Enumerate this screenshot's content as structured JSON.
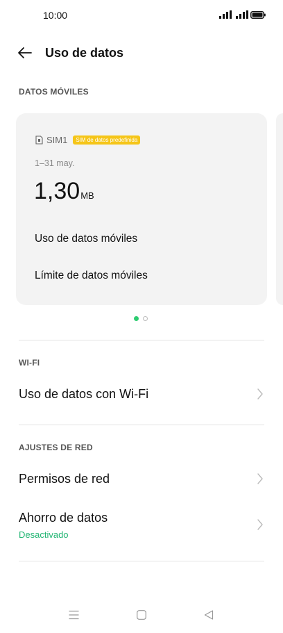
{
  "status": {
    "time": "10:00"
  },
  "header": {
    "title": "Uso de datos"
  },
  "mobile": {
    "section_label": "DATOS MÓVILES",
    "sim_name": "SIM1",
    "sim_badge": "SIM de datos predefinida",
    "period": "1–31 may.",
    "usage_value": "1,30",
    "usage_unit": "MB",
    "items": [
      "Uso de datos móviles",
      "Límite de datos móviles"
    ],
    "pager": {
      "pages": 2,
      "active": 0
    }
  },
  "wifi": {
    "section_label": "WI-FI",
    "item": "Uso de datos con Wi-Fi"
  },
  "network": {
    "section_label": "AJUSTES DE RED",
    "permissions": "Permisos de red",
    "saver_title": "Ahorro de datos",
    "saver_status": "Desactivado"
  },
  "colors": {
    "accent": "#22b573",
    "badge": "#f5c518"
  },
  "icons": [
    "back-arrow-icon",
    "sim-card-icon",
    "chevron-right-icon",
    "signal-icon",
    "battery-icon",
    "menu-icon",
    "home-icon",
    "back-icon"
  ]
}
